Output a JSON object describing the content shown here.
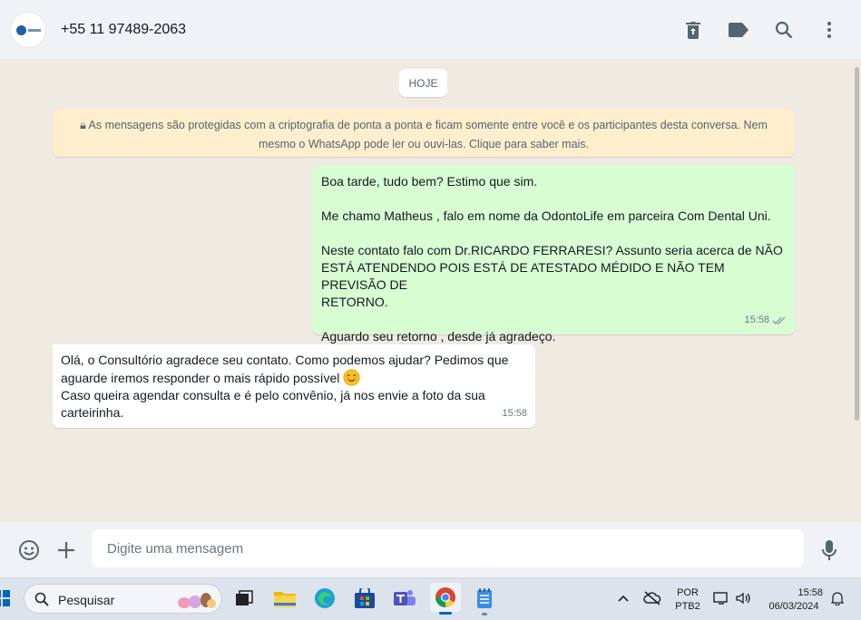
{
  "header": {
    "contact_name": "+55 11 97489-2063",
    "icons": [
      "delete-icon",
      "label-icon",
      "search-icon",
      "menu-icon"
    ]
  },
  "chat": {
    "date_chip": "HOJE",
    "encryption_notice_line1": "As mensagens são protegidas com a criptografia de ponta a ponta e ficam somente entre você e os participantes desta conversa. Nem",
    "encryption_notice_line2": "mesmo o WhatsApp pode ler ou ouvi-las. Clique para saber mais.",
    "outgoing": {
      "p1": "Boa tarde, tudo bem? Estimo que sim.",
      "p2": "Me chamo Matheus , falo em nome da OdontoLife em parceira Com Dental Uni.",
      "p3_line1": "Neste contato falo com Dr.RICARDO FERRARESI? Assunto seria acerca de NÃO",
      "p3_line2": "ESTÁ ATENDENDO POIS ESTÁ DE ATESTADO MÉDIDO E NÃO TEM PREVISÃO DE",
      "p3_line3": "RETORNO.",
      "p4": "Aguardo seu retorno , desde já agradeço.",
      "time": "15:58",
      "status_icon": "double-check-icon"
    },
    "incoming": {
      "line1": "Olá, o Consultório agradece seu contato. Como podemos ajudar? Pedimos que",
      "line2": "aguarde iremos responder o mais rápido possível",
      "emoji": "smiling-face-icon",
      "line3": "Caso queira agendar consulta e é pelo convênio, já nos envie a foto da sua",
      "line4": "carteirinha.",
      "time": "15:58"
    }
  },
  "composer": {
    "placeholder": "Digite uma mensagem",
    "icons": [
      "emoji-icon",
      "plus-icon",
      "microphone-icon"
    ]
  },
  "taskbar": {
    "search_label": "Pesquisar",
    "language_top": "POR",
    "language_bottom": "PTB2",
    "clock_time": "15:58",
    "clock_date": "06/03/2024",
    "colors": {
      "accent": "#0067c0",
      "chrome_red": "#db4437"
    }
  }
}
